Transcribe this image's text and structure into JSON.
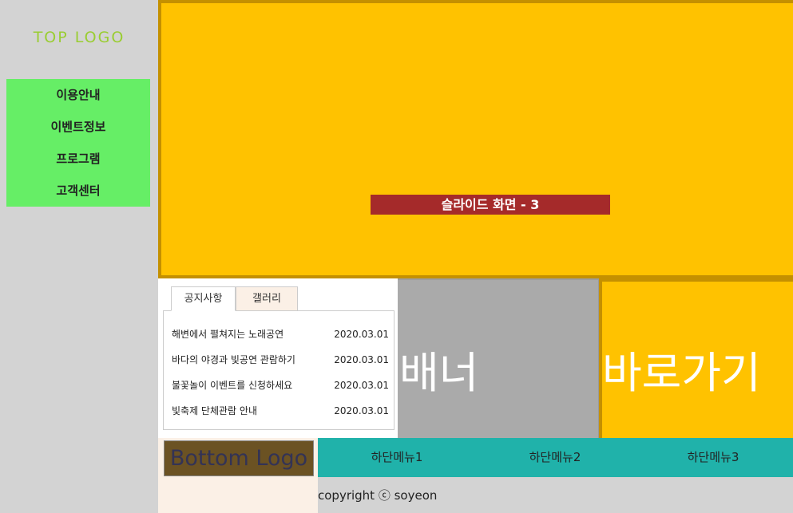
{
  "header": {
    "logo": "TOP LOGO"
  },
  "menu": {
    "items": [
      "이용안내",
      "이벤트정보",
      "프로그램",
      "고객센터"
    ]
  },
  "slide": {
    "label": "슬라이드 화면 - 3"
  },
  "tabs": {
    "notice": "공지사항",
    "gallery": "갤러리"
  },
  "notices": [
    {
      "title": "해변에서 펼쳐지는 노래공연",
      "date": "2020.03.01"
    },
    {
      "title": "바다의 야경과 빛공연 관람하기",
      "date": "2020.03.01"
    },
    {
      "title": "불꽃놀이 이벤트를 신청하세요",
      "date": "2020.03.01"
    },
    {
      "title": "빛축제 단체관람 안내",
      "date": "2020.03.01"
    }
  ],
  "banner": {
    "label": "배너"
  },
  "shortcut": {
    "label": "바로가기"
  },
  "footer": {
    "logo": "Bottom Logo",
    "menu": [
      "하단메뉴1",
      "하단메뉴2",
      "하단메뉴3"
    ],
    "copyright": "copyright ⓒ soyeon"
  }
}
